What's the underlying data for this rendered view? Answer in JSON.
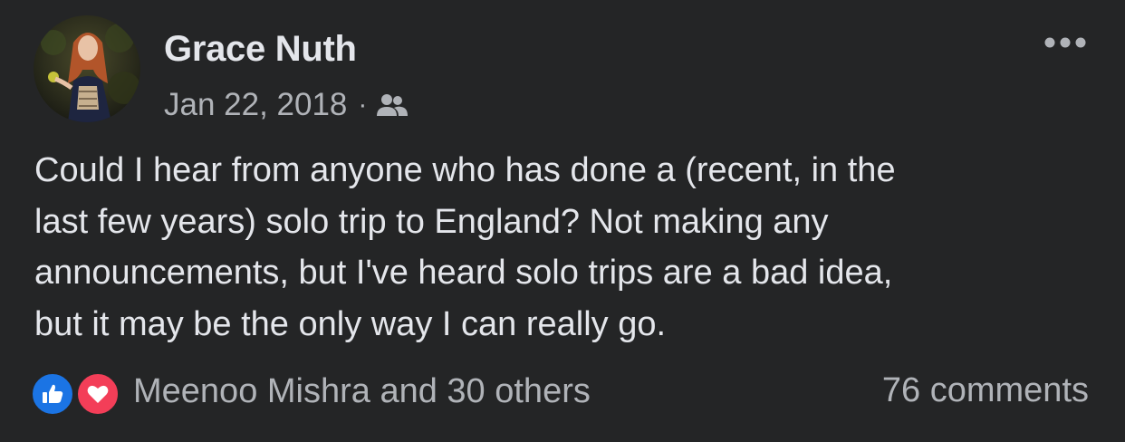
{
  "post": {
    "author": "Grace Nuth",
    "date": "Jan 22, 2018",
    "separator": "·",
    "privacy_icon": "group-icon",
    "text": "Could I hear from anyone who has done a (recent, in the\nlast few years) solo trip to England? Not making any\nannouncements, but I've heard solo trips are a bad idea,\nbut it may be the only way I can really go.",
    "reactions": {
      "icons": [
        "like-icon",
        "love-icon"
      ],
      "summary": "Meenoo Mishra and 30 others"
    },
    "comments": "76 comments"
  },
  "colors": {
    "background": "#242526",
    "primary_text": "#e4e6eb",
    "secondary_text": "#b0b3b8",
    "like_blue": "#1b74e4",
    "love_red": "#f33e58"
  }
}
